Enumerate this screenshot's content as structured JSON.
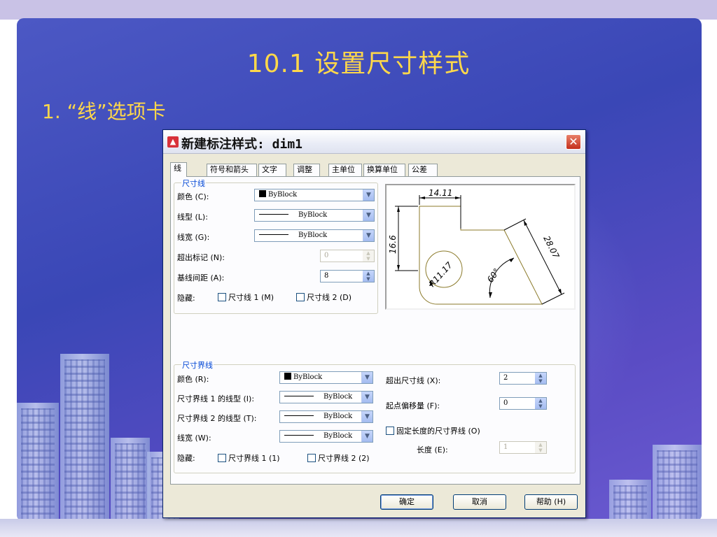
{
  "slide": {
    "title": "10.1 设置尺寸样式",
    "subtitle": "1. “线”选项卡"
  },
  "dialog": {
    "title": "新建标注样式: dim1",
    "close_symbol": "✕",
    "tabs": [
      "线",
      "符号和箭头",
      "文字",
      "调整",
      "主单位",
      "换算单位",
      "公差"
    ],
    "active_tab": "线",
    "dim_lines": {
      "group_label": "尺寸线",
      "color_label": "颜色 (C):",
      "color_value": "ByBlock",
      "linetype_label": "线型 (L):",
      "linetype_value": "ByBlock",
      "lineweight_label": "线宽 (G):",
      "lineweight_value": "ByBlock",
      "extend_ticks_label": "超出标记 (N):",
      "extend_ticks_value": "0",
      "baseline_spacing_label": "基线间距 (A):",
      "baseline_spacing_value": "8",
      "suppress_label": "隐藏:",
      "suppress_1": "尺寸线 1 (M)",
      "suppress_2": "尺寸线 2 (D)"
    },
    "ext_lines": {
      "group_label": "尺寸界线",
      "color_label": "颜色 (R):",
      "color_value": "ByBlock",
      "linetype1_label": "尺寸界线 1 的线型 (I):",
      "linetype1_value": "ByBlock",
      "linetype2_label": "尺寸界线 2 的线型 (T):",
      "linetype2_value": "ByBlock",
      "lineweight_label": "线宽 (W):",
      "lineweight_value": "ByBlock",
      "suppress_label": "隐藏:",
      "suppress_1": "尺寸界线 1 (1)",
      "suppress_2": "尺寸界线 2 (2)",
      "extend_label": "超出尺寸线 (X):",
      "extend_value": "2",
      "offset_label": "起点偏移量 (F):",
      "offset_value": "0",
      "fixed_length_label": "固定长度的尺寸界线 (O)",
      "length_label": "长度 (E):",
      "length_value": "1"
    },
    "preview": {
      "dim_top": "14.11",
      "dim_left": "16.6",
      "dim_right": "28.07",
      "dim_radius": "R11.17",
      "dim_angle": "60°"
    },
    "buttons": {
      "ok": "确定",
      "cancel": "取消",
      "help": "帮助 (H)"
    },
    "colors": {
      "group_label": "#0046d5",
      "preview_geometry": "#8b7a2a",
      "title_text": "#ffd84a"
    }
  }
}
